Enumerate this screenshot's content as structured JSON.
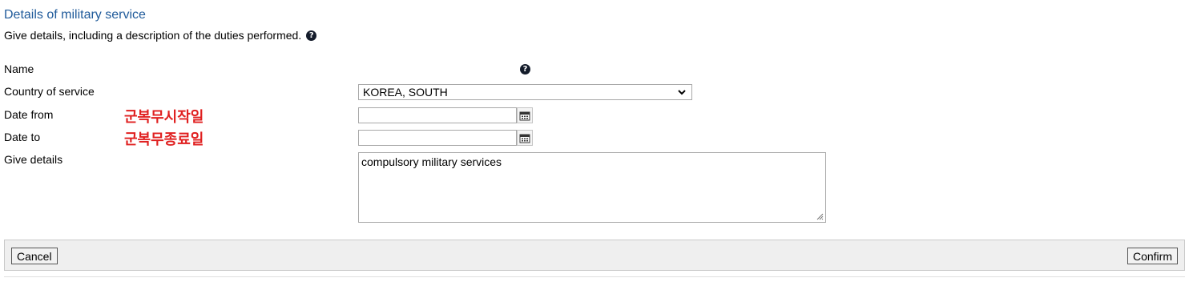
{
  "section": {
    "title": "Details of military service",
    "subtitle": "Give details, including a description of the duties performed.",
    "help_icon": "question-circle-icon"
  },
  "form": {
    "name_label": "Name",
    "country_label": "Country of service",
    "country_value": "KOREA, SOUTH",
    "date_from_label": "Date from",
    "date_from_value": "",
    "date_to_label": "Date to",
    "date_to_value": "",
    "details_label": "Give details",
    "details_value": "compulsory military services",
    "calendar_icon": "calendar-icon"
  },
  "annotations": {
    "date_from_note": "군복무시작일",
    "date_to_note": "군복무종료일",
    "color": "#e02020"
  },
  "footer": {
    "cancel_label": "Cancel",
    "confirm_label": "Confirm"
  },
  "colors": {
    "title": "#1f5a9a",
    "help_icon_bg": "#141c2b",
    "footer_bg": "#efefef"
  }
}
